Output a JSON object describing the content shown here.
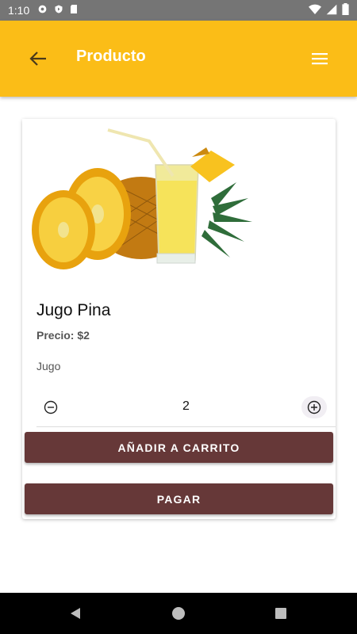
{
  "status_bar": {
    "time": "1:10",
    "left_icons": [
      "gear-icon",
      "shield-icon",
      "sd-card-icon"
    ],
    "right_icons": [
      "wifi-icon",
      "signal-icon",
      "battery-icon"
    ]
  },
  "app_bar": {
    "title": "Producto",
    "color": "#FBBD17"
  },
  "product": {
    "name": "Jugo Pina",
    "price": "Precio: $2",
    "category": "Jugo",
    "quantity": "2"
  },
  "actions": {
    "add_to_cart": "AÑADIR A CARRITO",
    "pay": "PAGAR",
    "button_color": "#663838"
  },
  "nav_bar": {
    "buttons": [
      "back-triangle-icon",
      "home-circle-icon",
      "recents-square-icon"
    ]
  }
}
